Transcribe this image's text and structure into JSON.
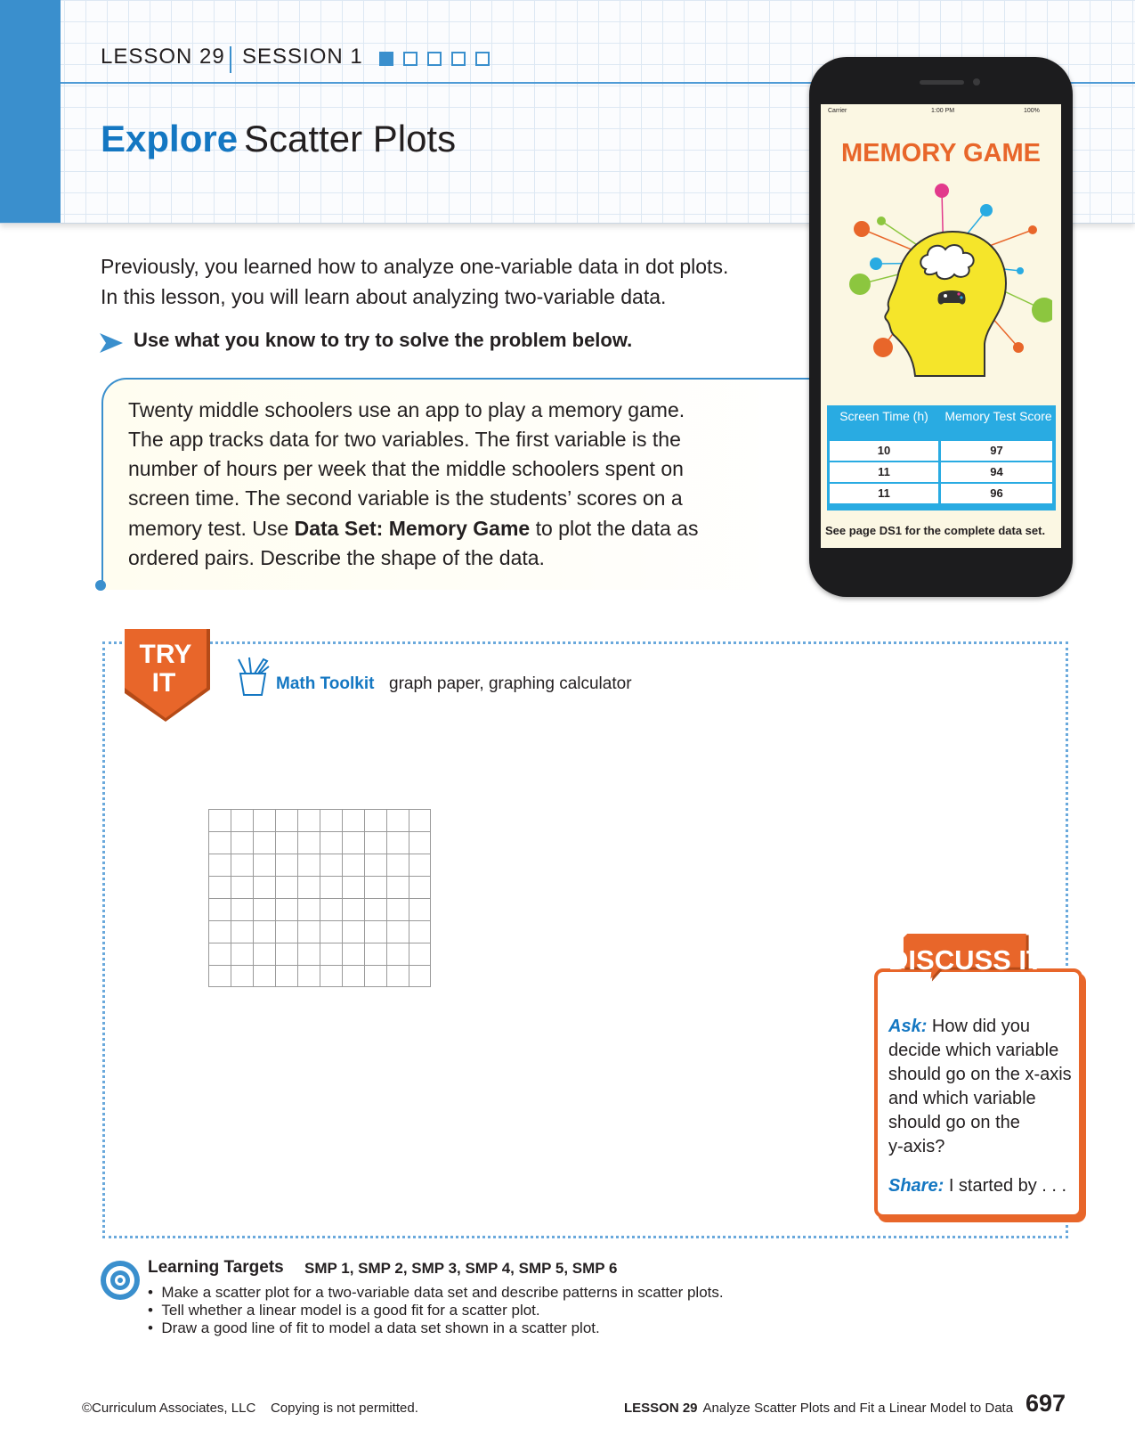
{
  "header": {
    "lesson": "LESSON 29",
    "session": "SESSION 1",
    "progress": {
      "current": 1,
      "total": 5
    },
    "title_emphasis": "Explore",
    "title_rest": "Scatter Plots"
  },
  "intro": {
    "line1": "Previously, you learned how to analyze one-variable data in dot plots.",
    "line2": "In this lesson, you will learn about analyzing two-variable data.",
    "instruction": "Use what you know to try to solve the problem below."
  },
  "problem": {
    "lines": [
      "Twenty middle schoolers use an app to play a memory game.",
      "The app tracks data for two variables. The first variable is the",
      "number of hours per week that the middle schoolers spent on",
      "screen time. The second variable is the students’ scores on a"
    ],
    "line5_pre": "memory test. Use ",
    "line5_bold": "Data Set: Memory Game",
    "line5_post": " to plot the data as",
    "line6": "ordered pairs. Describe the shape of the data."
  },
  "phone": {
    "status": {
      "carrier": "Carrier",
      "time": "1:00 PM",
      "battery": "100%"
    },
    "game_title": "MEMORY GAME",
    "table": {
      "headers": [
        "Screen Time (h)",
        "Memory Test Score"
      ],
      "rows": [
        [
          "10",
          "97"
        ],
        [
          "11",
          "94"
        ],
        [
          "11",
          "96"
        ]
      ]
    },
    "footnote": "See page DS1 for the complete data set."
  },
  "try_it": {
    "badge_line1": "TRY",
    "badge_line2": "IT",
    "toolkit_label": "Math Toolkit",
    "toolkit_items": "graph paper, graphing calculator"
  },
  "discuss": {
    "title": "DISCUSS IT",
    "ask_label": "Ask:",
    "ask_lines": [
      "How did you",
      "decide which variable",
      "should go on the x-axis",
      "and which variable",
      "should go on the",
      "y-axis?"
    ],
    "share_label": "Share:",
    "share_text": "I started by . . ."
  },
  "learning_targets": {
    "title": "Learning Targets",
    "smp": "SMP 1, SMP 2, SMP 3, SMP 4, SMP 5, SMP 6",
    "items": [
      "Make a scatter plot for a two-variable data set and describe patterns in scatter plots.",
      "Tell whether a linear model is a good fit for a scatter plot.",
      "Draw a good line of fit to model a data set shown in a scatter plot."
    ]
  },
  "footer": {
    "copyright": "©Curriculum Associates, LLC    Copying is not permitted.",
    "lesson": "LESSON 29",
    "lesson_title": "Analyze Scatter Plots and Fit a Linear Model to Data",
    "page_number": "697"
  },
  "colors": {
    "blue": "#3a8fcd",
    "title_blue": "#1477c2",
    "orange": "#e8662a",
    "table_blue": "#29abe2"
  }
}
